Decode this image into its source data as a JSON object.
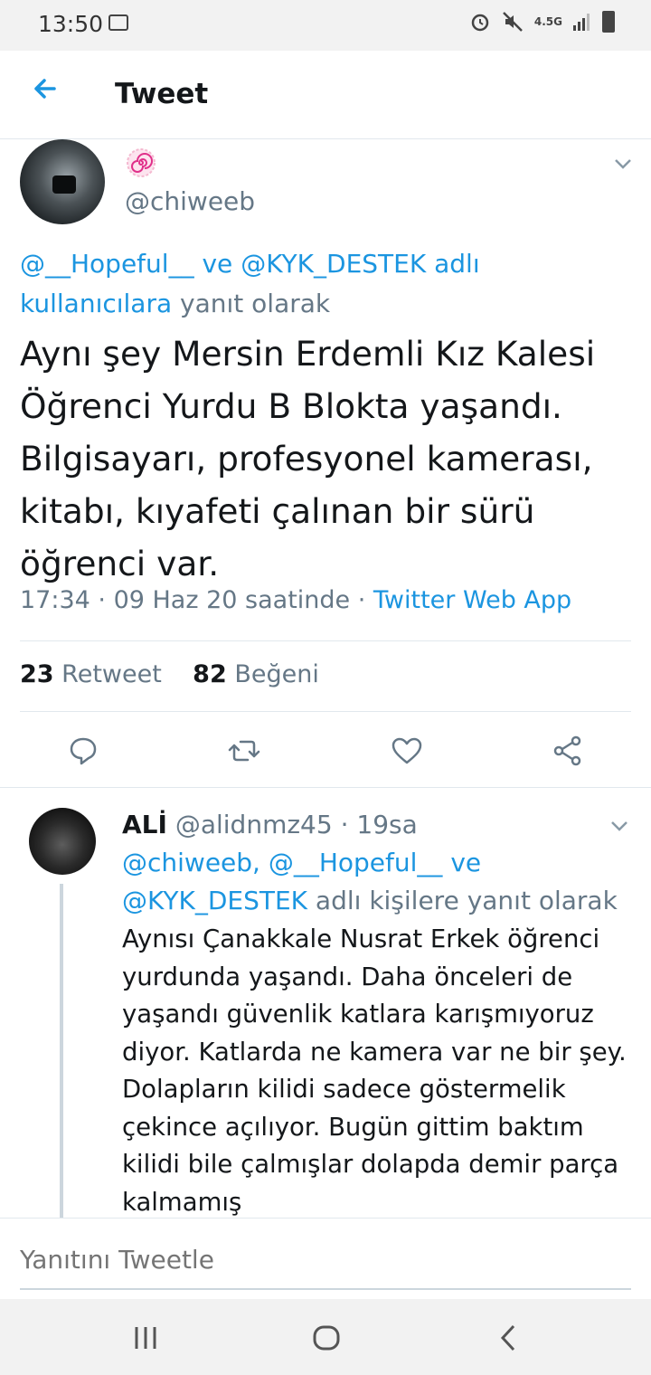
{
  "status_bar": {
    "time": "13:50",
    "network": "4.5G",
    "icons": [
      "image-icon",
      "alarm-icon",
      "mute-icon",
      "signal-icon",
      "battery-icon"
    ]
  },
  "header": {
    "title": "Tweet",
    "back_icon": "arrow-left-icon"
  },
  "tweet": {
    "display_name_icon": "spiral-emoji-icon",
    "handle": "@chiweeb",
    "reply_to": {
      "user1": "@__Hopeful__",
      "connector": "ve",
      "user2": "@KYK_DESTEK",
      "suffix_link": "adlı kullanıcılara",
      "suffix": "yanıt olarak"
    },
    "text": "Aynı şey Mersin Erdemli Kız Kalesi\nÖğrenci Yurdu B Blokta yaşandı.\nBilgisayarı, profesyonel kamerası,\nkitabı, kıyafeti çalınan bir sürü\nöğrenci var.",
    "time": "17:34",
    "date": "09 Haz 20 saatinde",
    "source": "Twitter Web App",
    "retweet_count": "23",
    "retweet_label": "Retweet",
    "like_count": "82",
    "like_label": "Beğeni"
  },
  "reply": {
    "name": "ALİ",
    "handle": "@alidnmz45",
    "age": "19sa",
    "reply_to_users": "@chiweeb, @__Hopeful__",
    "reply_to_connector": "ve",
    "reply_to_user3": "@KYK_DESTEK",
    "reply_to_suffix": "adlı kişilere yanıt olarak",
    "text": "Aynısı Çanakkale Nusrat Erkek öğrenci yurdunda yaşandı. Daha önceleri de yaşandı güvenlik katlara karışmıyoruz diyor. Katlarda ne kamera var ne bir şey. Dolapların kilidi sadece göstermelik çekince açılıyor. Bugün gittim baktım kilidi bile çalmışlar dolapda demir parça kalmamış"
  },
  "compose": {
    "placeholder": "Yanıtını Tweetle"
  },
  "colors": {
    "link": "#1b95e0",
    "secondary_text": "#657786",
    "primary_text": "#14171a",
    "divider": "#e1e8ed"
  }
}
